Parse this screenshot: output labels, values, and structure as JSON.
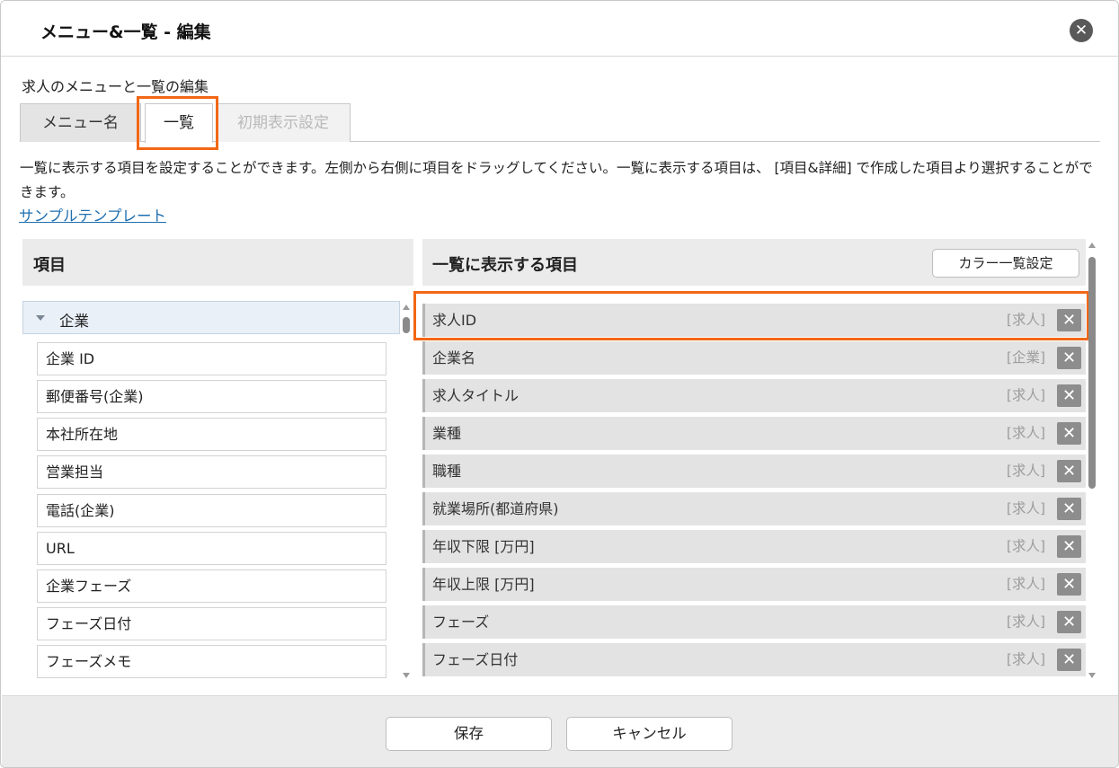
{
  "dialog": {
    "title": "メニュー&一覧 - 編集",
    "close_icon": "close-icon"
  },
  "subtitle": "求人のメニューと一覧の編集",
  "tabs": [
    {
      "label": "メニュー名",
      "state": "inactive"
    },
    {
      "label": "一覧",
      "state": "active"
    },
    {
      "label": "初期表示設定",
      "state": "disabled"
    }
  ],
  "description": "一覧に表示する項目を設定することができます。左側から右側に項目をドラッグしてください。一覧に表示する項目は、 [項目&詳細] で作成した項目より選択することができます。",
  "sample_link": "サンプルテンプレート",
  "left_panel": {
    "header": "項目",
    "group": {
      "label": "企業",
      "icon": "triangle-down-icon"
    },
    "items": [
      "企業 ID",
      "郵便番号(企業)",
      "本社所在地",
      "営業担当",
      "電話(企業)",
      "URL",
      "企業フェーズ",
      "フェーズ日付",
      "フェーズメモ"
    ]
  },
  "right_panel": {
    "header": "一覧に表示する項目",
    "color_button": "カラー一覧設定",
    "items": [
      {
        "label": "求人ID",
        "tag": "[求人]"
      },
      {
        "label": "企業名",
        "tag": "[企業]"
      },
      {
        "label": "求人タイトル",
        "tag": "[求人]"
      },
      {
        "label": "業種",
        "tag": "[求人]"
      },
      {
        "label": "職種",
        "tag": "[求人]"
      },
      {
        "label": "就業場所(都道府県)",
        "tag": "[求人]"
      },
      {
        "label": "年収下限 [万円]",
        "tag": "[求人]"
      },
      {
        "label": "年収上限 [万円]",
        "tag": "[求人]"
      },
      {
        "label": "フェーズ",
        "tag": "[求人]"
      },
      {
        "label": "フェーズ日付",
        "tag": "[求人]"
      }
    ],
    "delete_icon": "close-icon"
  },
  "footer": {
    "save_label": "保存",
    "cancel_label": "キャンセル"
  },
  "colors": {
    "highlight": "#f26716",
    "link": "#1f6fb0",
    "delete_button": "#8d8d8d"
  }
}
